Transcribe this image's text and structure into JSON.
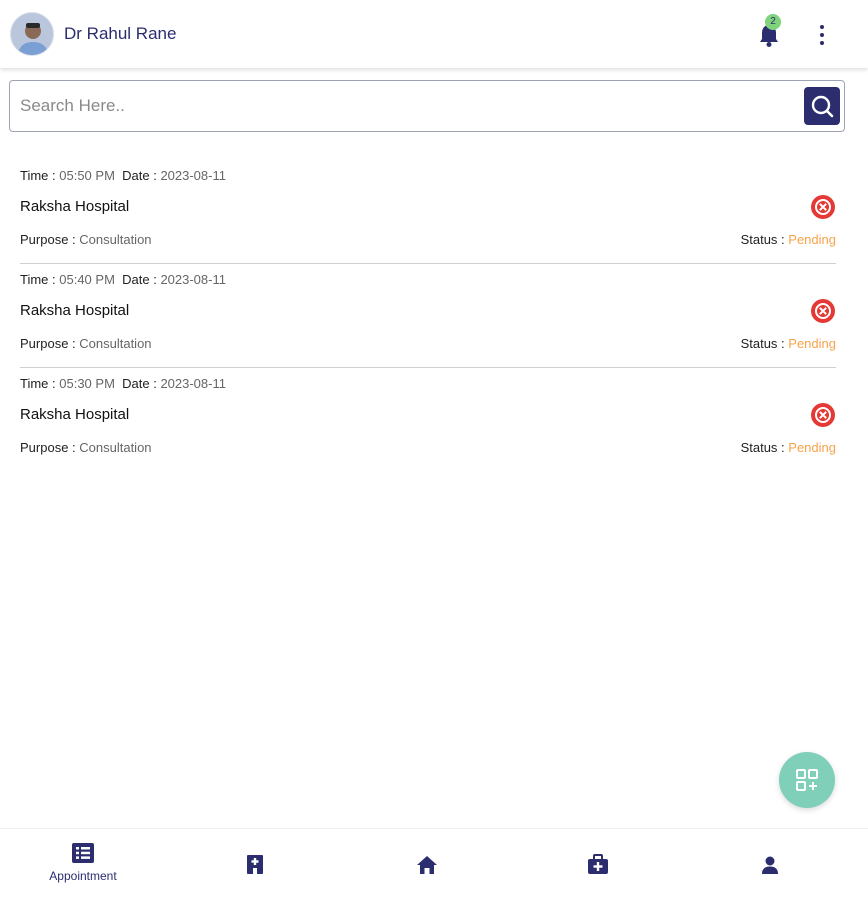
{
  "header": {
    "user_name": "Dr Rahul Rane",
    "notification_count": "2"
  },
  "search": {
    "placeholder": "Search Here.."
  },
  "appointments": [
    {
      "time_label": "Time : ",
      "time": "05:50 PM",
      "date_label": "Date : ",
      "date": "2023-08-11",
      "hospital": "Raksha Hospital",
      "purpose_label": "Purpose : ",
      "purpose": "Consultation",
      "status_label": "Status : ",
      "status": "Pending"
    },
    {
      "time_label": "Time : ",
      "time": "05:40 PM",
      "date_label": "Date : ",
      "date": "2023-08-11",
      "hospital": "Raksha Hospital",
      "purpose_label": "Purpose : ",
      "purpose": "Consultation",
      "status_label": "Status : ",
      "status": "Pending"
    },
    {
      "time_label": "Time : ",
      "time": "05:30 PM",
      "date_label": "Date : ",
      "date": "2023-08-11",
      "hospital": "Raksha Hospital",
      "purpose_label": "Purpose : ",
      "purpose": "Consultation",
      "status_label": "Status : ",
      "status": "Pending"
    }
  ],
  "bottom_nav": {
    "items": [
      {
        "icon": "appointment-list-icon",
        "label": "Appointment",
        "active": true
      },
      {
        "icon": "hospital-icon",
        "label": ""
      },
      {
        "icon": "home-icon",
        "label": ""
      },
      {
        "icon": "medical-kit-icon",
        "label": ""
      },
      {
        "icon": "profile-icon",
        "label": ""
      }
    ]
  },
  "colors": {
    "primary": "#2b2d6e",
    "pending": "#f7a34b",
    "cancel": "#e53935",
    "fab": "#7fcfb9",
    "badge": "#7ed37b"
  }
}
